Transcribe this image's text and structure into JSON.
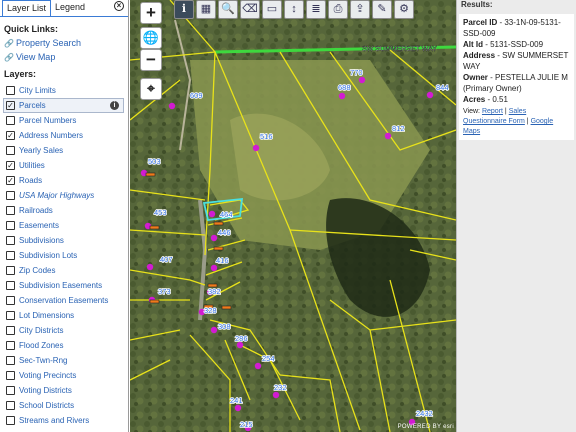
{
  "tabs": {
    "layer_list": "Layer List",
    "legend": "Legend",
    "close": "×"
  },
  "quick_links": {
    "title": "Quick Links:",
    "items": [
      {
        "label": "Property Search"
      },
      {
        "label": "View Map"
      }
    ]
  },
  "layers": {
    "title": "Layers:",
    "items": [
      {
        "label": "City Limits",
        "checked": false,
        "italic": false
      },
      {
        "label": "Parcels",
        "checked": true,
        "italic": false,
        "selected": true
      },
      {
        "label": "Parcel Numbers",
        "checked": false,
        "italic": false
      },
      {
        "label": "Address Numbers",
        "checked": true,
        "italic": false
      },
      {
        "label": "Yearly Sales",
        "checked": false,
        "italic": false
      },
      {
        "label": "Utilities",
        "checked": true,
        "italic": false
      },
      {
        "label": "Roads",
        "checked": true,
        "italic": false
      },
      {
        "label": "USA Major Highways",
        "checked": false,
        "italic": true
      },
      {
        "label": "Railroads",
        "checked": false,
        "italic": false
      },
      {
        "label": "Easements",
        "checked": false,
        "italic": false
      },
      {
        "label": "Subdivisions",
        "checked": false,
        "italic": false
      },
      {
        "label": "Subdivision Lots",
        "checked": false,
        "italic": false
      },
      {
        "label": "Zip Codes",
        "checked": false,
        "italic": false
      },
      {
        "label": "Subdivision Easements",
        "checked": false,
        "italic": false
      },
      {
        "label": "Conservation Easements",
        "checked": false,
        "italic": false
      },
      {
        "label": "Lot Dimensions",
        "checked": false,
        "italic": false
      },
      {
        "label": "City Districts",
        "checked": false,
        "italic": false
      },
      {
        "label": "Flood Zones",
        "checked": false,
        "italic": false
      },
      {
        "label": "Sec-Twn-Rng",
        "checked": false,
        "italic": false
      },
      {
        "label": "Voting Precincts",
        "checked": false,
        "italic": false
      },
      {
        "label": "Voting Districts",
        "checked": false,
        "italic": false
      },
      {
        "label": "School Districts",
        "checked": false,
        "italic": false
      },
      {
        "label": "Streams and Rivers",
        "checked": false,
        "italic": false
      }
    ]
  },
  "map": {
    "road_label": "SW SUMMERSET WAY",
    "address_labels": [
      "609",
      "770",
      "688",
      "844",
      "516",
      "812",
      "503",
      "453",
      "464",
      "446",
      "407",
      "416",
      "373",
      "382",
      "328",
      "308",
      "286",
      "254",
      "232",
      "241",
      "215",
      "2432"
    ],
    "credit": "POWERED BY esri",
    "colors": {
      "parcel_lines": "#e8e21a",
      "selected_parcel": "#49e0e0",
      "road": "#3ed83e",
      "address_marker": "#d21bd2",
      "label": "#2f6fe0"
    }
  },
  "results": {
    "title": "Results:",
    "parcel_id_label": "Parcel ID",
    "parcel_id": "33-1N-09-5131-SSD-009",
    "alt_id_label": "Alt Id",
    "alt_id": "5131-SSD-009",
    "address_label": "Address",
    "address": "SW SUMMERSET WAY",
    "owner_label": "Owner",
    "owner": "PESTELLA JULIE M (Primary Owner)",
    "acres_label": "Acres",
    "acres": "0.51",
    "view_label": "View:",
    "links": [
      "Report",
      "Sales Questionnaire Form",
      "Google Maps"
    ]
  }
}
